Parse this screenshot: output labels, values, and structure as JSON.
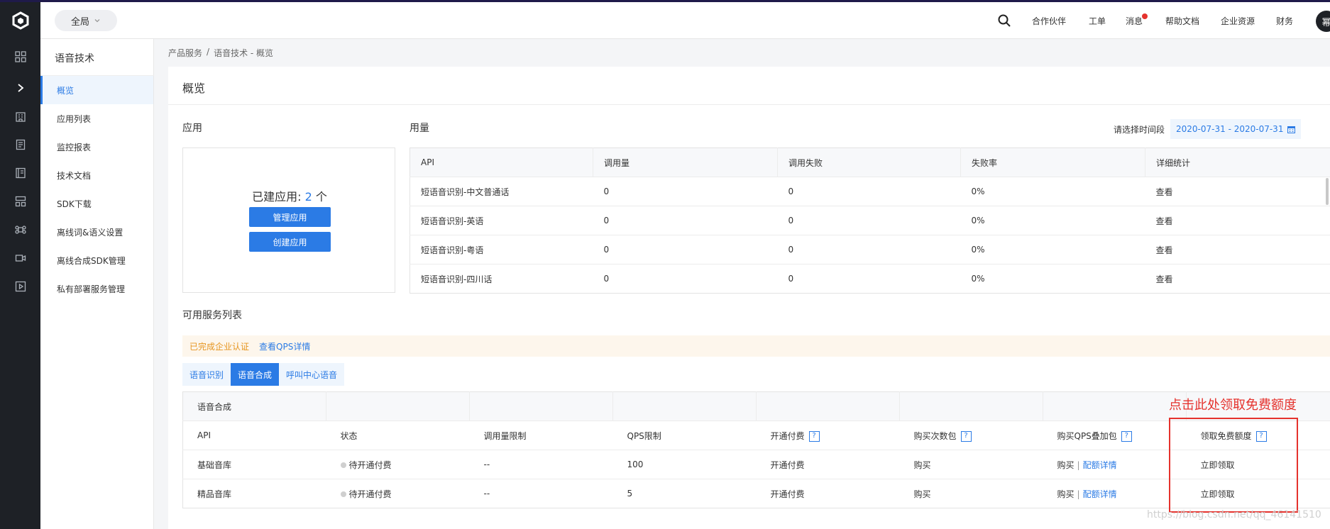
{
  "header": {
    "scope_label": "全局",
    "nav": [
      "合作伙伴",
      "工单",
      "消息",
      "帮助文档",
      "企业资源",
      "财务"
    ],
    "avatar_text": "幂"
  },
  "sidebar": {
    "title": "语音技术",
    "items": [
      {
        "label": "概览",
        "active": true
      },
      {
        "label": "应用列表"
      },
      {
        "label": "监控报表"
      },
      {
        "label": "技术文档"
      },
      {
        "label": "SDK下载"
      },
      {
        "label": "离线词&语义设置"
      },
      {
        "label": "离线合成SDK管理"
      },
      {
        "label": "私有部署服务管理"
      }
    ]
  },
  "breadcrumb": {
    "root": "产品服务",
    "sep": "/",
    "current": "语音技术 - 概览"
  },
  "page": {
    "title": "概览"
  },
  "apps": {
    "section_title": "应用",
    "created_prefix": "已建应用: ",
    "created_count": "2",
    "created_suffix": " 个",
    "manage_label": "管理应用",
    "create_label": "创建应用"
  },
  "usage": {
    "section_title": "用量",
    "date_label": "请选择时间段",
    "date_range": "2020-07-31 - 2020-07-31",
    "columns": [
      "API",
      "调用量",
      "调用失败",
      "失败率",
      "详细统计"
    ],
    "rows": [
      [
        "短语音识别-中文普通话",
        "0",
        "0",
        "0%",
        "查看"
      ],
      [
        "短语音识别-英语",
        "0",
        "0",
        "0%",
        "查看"
      ],
      [
        "短语音识别-粤语",
        "0",
        "0",
        "0%",
        "查看"
      ],
      [
        "短语音识别-四川话",
        "0",
        "0",
        "0%",
        "查看"
      ]
    ]
  },
  "services": {
    "section_title": "可用服务列表",
    "notice_verified": "已完成企业认证",
    "notice_link": "查看QPS详情",
    "tabs": [
      {
        "label": "语音识别"
      },
      {
        "label": "语音合成",
        "active": true
      },
      {
        "label": "呼叫中心语音"
      }
    ],
    "group_title": "语音合成",
    "columns": [
      "API",
      "状态",
      "调用量限制",
      "QPS限制",
      "开通付费",
      "购买次数包",
      "购买QPS叠加包",
      "领取免费额度"
    ],
    "rows": [
      {
        "api": "基础音库",
        "status": "待开通付费",
        "limit": "--",
        "qps": "100",
        "pay": "开通付费",
        "buy": "购买",
        "qps_buy": "购买",
        "qps_detail": "配额详情",
        "free": "立即领取"
      },
      {
        "api": "精品音库",
        "status": "待开通付费",
        "limit": "--",
        "qps": "5",
        "pay": "开通付费",
        "buy": "购买",
        "qps_buy": "购买",
        "qps_detail": "配额详情",
        "free": "立即领取"
      }
    ]
  },
  "annotation": {
    "text": "点击此处领取免费额度"
  },
  "watermark": "https://blog.csdn.net/qq_46141510",
  "colors": {
    "accent": "#2b7be5",
    "warning": "#e6951f",
    "annotation": "#e5322d",
    "rail": "#1e2126"
  }
}
